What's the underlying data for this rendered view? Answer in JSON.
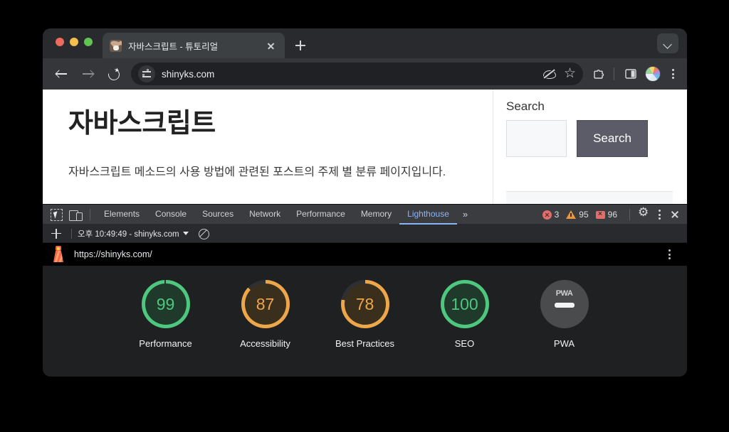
{
  "browser": {
    "tab": {
      "title": "자바스크립트 - 튜토리얼",
      "favicon_name": "bear-favicon"
    },
    "new_tab_label": "+",
    "tab_search_label": "",
    "omnibox": {
      "url": "shinyks.com",
      "site_settings_icon": "tune-icon",
      "hide_icon": "eye-slash-icon",
      "bookmark_icon": "star-icon"
    },
    "toolbar": {
      "back": "back-arrow-icon",
      "forward": "forward-arrow-icon",
      "reload": "reload-icon",
      "extensions": "puzzle-piece-icon",
      "side_panel": "side-panel-icon",
      "profile": "profile-avatar",
      "menu": "three-dot-menu-icon"
    }
  },
  "page": {
    "heading": "자바스크립트",
    "paragraph": "자바스크립트 메소드의 사용 방법에 관련된 포스트의 주제 별 분류 페이지입니다.",
    "sidebar": {
      "search_title": "Search",
      "search_value": "",
      "search_placeholder": "",
      "search_button_label": "Search"
    }
  },
  "devtools": {
    "tabs": [
      {
        "label": "Elements",
        "active": false
      },
      {
        "label": "Console",
        "active": false
      },
      {
        "label": "Sources",
        "active": false
      },
      {
        "label": "Network",
        "active": false
      },
      {
        "label": "Performance",
        "active": false
      },
      {
        "label": "Memory",
        "active": false
      },
      {
        "label": "Lighthouse",
        "active": true
      }
    ],
    "more_tabs_label": "»",
    "counters": {
      "errors": "3",
      "warnings": "95",
      "infos": "96"
    },
    "icons": {
      "inspect": "inspect-element-icon",
      "device_toolbar": "device-toolbar-icon",
      "settings": "gear-icon",
      "menu": "three-dot-menu-icon",
      "close": "close-icon"
    },
    "lighthouse_toolbar": {
      "add_label": "+",
      "report_select": "오후 10:49:49 - shinyks.com",
      "clear_icon": "clear-icon"
    },
    "report": {
      "url": "https://shinyks.com/",
      "logo_name": "lighthouse-logo",
      "menu_icon": "three-dot-menu-icon"
    }
  },
  "chart_data": {
    "type": "gauge",
    "title": "Lighthouse Scores",
    "scale": [
      0,
      100
    ],
    "categories": [
      "Performance",
      "Accessibility",
      "Best Practices",
      "SEO",
      "PWA"
    ],
    "values": [
      99,
      87,
      78,
      100,
      null
    ],
    "gauges": [
      {
        "label": "Performance",
        "value": 99,
        "display": "99",
        "color": "#4ec77f",
        "track": "#1f3a2a",
        "status": "pass"
      },
      {
        "label": "Accessibility",
        "value": 87,
        "display": "87",
        "color": "#eda64a",
        "track": "#3a2f1c",
        "status": "average"
      },
      {
        "label": "Best Practices",
        "value": 78,
        "display": "78",
        "color": "#eda64a",
        "track": "#3a2f1c",
        "status": "average"
      },
      {
        "label": "SEO",
        "value": 100,
        "display": "100",
        "color": "#4ec77f",
        "track": "#1f3a2a",
        "status": "pass"
      },
      {
        "label": "PWA",
        "value": null,
        "display": "PWA",
        "color": "#4a4b4c",
        "track": "#4a4b4c",
        "status": "not-applicable"
      }
    ]
  },
  "colors": {
    "pass": "#4ec77f",
    "average": "#eda64a",
    "accent": "#8ab4f8",
    "error": "#e36d69",
    "warning": "#e8973d",
    "devtools_bg": "#202124",
    "report_bg": "#1f2021"
  }
}
